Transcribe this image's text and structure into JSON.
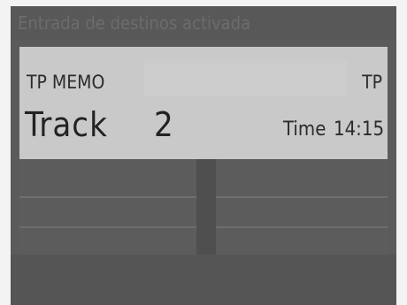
{
  "title_bar": {
    "text": "Entrada de destinos activada"
  },
  "panel": {
    "program_label": "TP MEMO",
    "tp_indicator": "TP",
    "track_label": "Track",
    "track_number": "2",
    "time_label": "Time",
    "time_value": "14:15"
  },
  "colors": {
    "screen_bg": "#5b5b5b",
    "panel_bg": "#c9c9c9",
    "text_dark": "#2b2b2b"
  }
}
